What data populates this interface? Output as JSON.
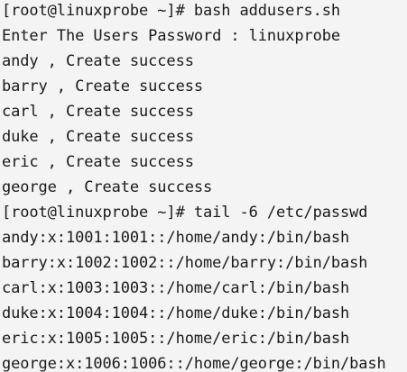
{
  "terminal": {
    "lines": [
      "[root@linuxprobe ~]# bash addusers.sh",
      "Enter The Users Password : linuxprobe",
      "andy , Create success",
      "barry , Create success",
      "carl , Create success",
      "duke , Create success",
      "eric , Create success",
      "george , Create success",
      "[root@linuxprobe ~]# tail -6 /etc/passwd",
      "andy:x:1001:1001::/home/andy:/bin/bash",
      "barry:x:1002:1002::/home/barry:/bin/bash",
      "carl:x:1003:1003::/home/carl:/bin/bash",
      "duke:x:1004:1004::/home/duke:/bin/bash",
      "eric:x:1005:1005::/home/eric:/bin/bash",
      "george:x:1006:1006::/home/george:/bin/bash"
    ]
  }
}
